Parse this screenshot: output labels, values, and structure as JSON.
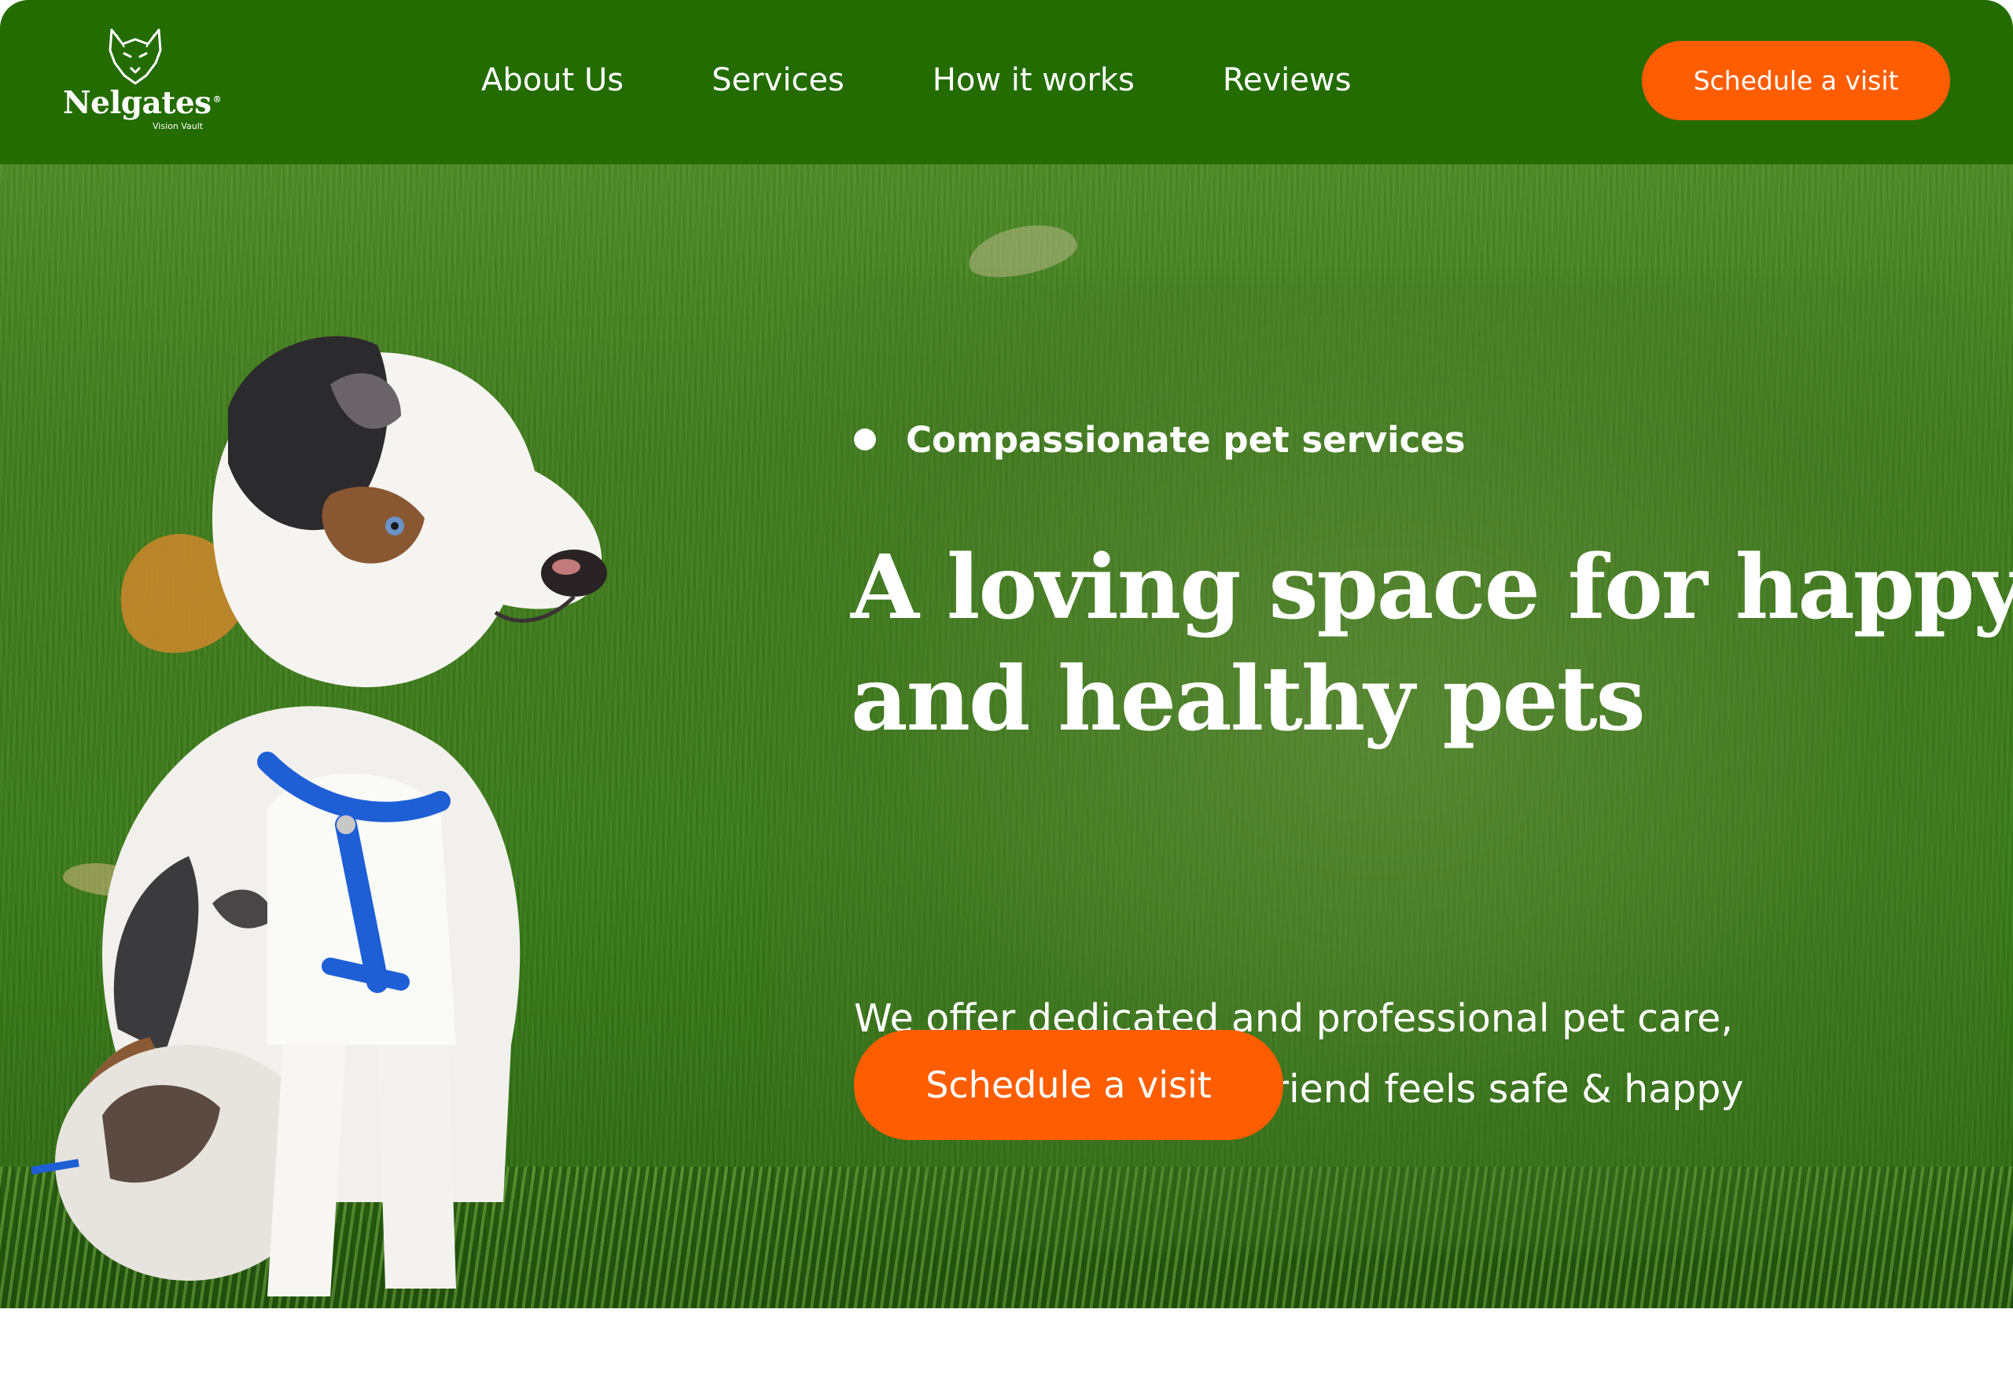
{
  "brand": {
    "name": "Nelgates",
    "registered_mark": "®",
    "tagline": "Vision Vault",
    "logo_icon": "wolf-head-icon"
  },
  "nav": {
    "items": [
      {
        "label": "About Us"
      },
      {
        "label": "Services"
      },
      {
        "label": "How it works"
      },
      {
        "label": "Reviews"
      }
    ],
    "cta_label": "Schedule a visit"
  },
  "hero": {
    "eyebrow": "Compassionate pet services",
    "headline_lines": [
      "A loving space for happy",
      "and healthy pets"
    ],
    "description_lines": [
      "We offer dedicated and professional pet care,",
      "ensuring every furry friend feels safe & happy"
    ],
    "cta_label": "Schedule a visit",
    "image": "puppy-on-grass"
  },
  "colors": {
    "header_bg": "#246b00",
    "accent": "#ff5d00",
    "text_on_dark": "#ffffff",
    "page_bg": "#ffffff"
  }
}
